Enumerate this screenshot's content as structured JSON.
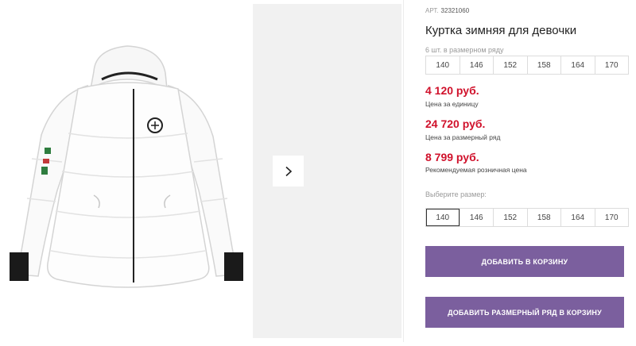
{
  "product": {
    "article_label": "АРТ.",
    "article_number": "32321060",
    "title": "Куртка зимняя для девочки"
  },
  "size_row": {
    "label": "6 шт. в размерном ряду",
    "sizes": [
      "140",
      "146",
      "152",
      "158",
      "164",
      "170"
    ]
  },
  "prices": [
    {
      "amount": "4 120 руб.",
      "note": "Цена за единицу"
    },
    {
      "amount": "24 720 руб.",
      "note": "Цена за размерный ряд"
    },
    {
      "amount": "8 799 руб.",
      "note": "Рекомендуемая розничная цена"
    }
  ],
  "size_select": {
    "label": "Выберите размер:",
    "sizes": [
      "140",
      "146",
      "152",
      "158",
      "164",
      "170"
    ],
    "selected": "140"
  },
  "buttons": {
    "add_to_cart": "ДОБАВИТЬ В КОРЗИНУ",
    "add_row_to_cart": "ДОБАВИТЬ РАЗМЕРНЫЙ РЯД В КОРЗИНУ"
  },
  "colors": {
    "price_red": "#d0112b",
    "button_purple": "#7b5f9e"
  },
  "icons": {
    "next": "chevron-right-icon"
  }
}
